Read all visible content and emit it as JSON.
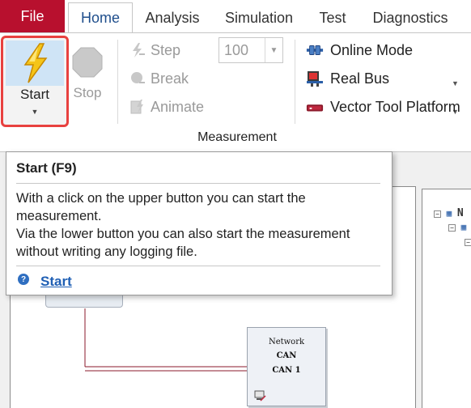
{
  "tabs": {
    "file": "File",
    "items": [
      "Home",
      "Analysis",
      "Simulation",
      "Test",
      "Diagnostics"
    ],
    "active": "Home"
  },
  "ribbon": {
    "start_label": "Start",
    "stop_label": "Stop",
    "step_label": "Step",
    "break_label": "Break",
    "animate_label": "Animate",
    "animation_speed_value": "100",
    "online_mode_label": "Online Mode",
    "real_bus_label": "Real Bus",
    "vector_tool_platform_label": "Vector Tool Platform",
    "group_label": "Measurement"
  },
  "tooltip": {
    "title": "Start (F9)",
    "line1": "With a click on the upper button you can start the measurement.",
    "line2": "Via the lower button you can also start the measurement without writing any logging file.",
    "link": "Start"
  },
  "network_node": {
    "line1": "Network",
    "line2": "CAN",
    "line3": "CAN 1"
  },
  "tree": {
    "root_label": "N"
  },
  "colors": {
    "file_tab": "#b8102e",
    "highlight_border": "#e8413f",
    "active_tab_text": "#1f4e8c",
    "link": "#1f5fb4"
  }
}
